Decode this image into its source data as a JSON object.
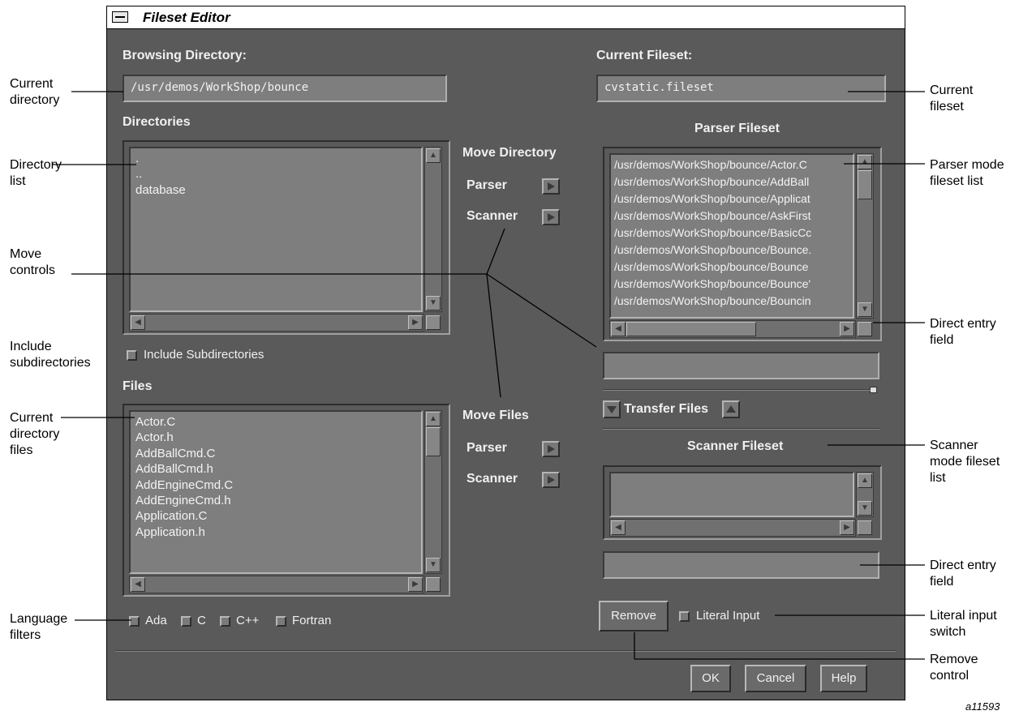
{
  "window": {
    "title": "Fileset Editor"
  },
  "left": {
    "browsing_label": "Browsing Directory:",
    "browsing_value": "/usr/demos/WorkShop/bounce",
    "directories_label": "Directories",
    "directories": [
      ".",
      "..",
      "database"
    ],
    "include_sub_label": "Include Subdirectories",
    "files_label": "Files",
    "files": [
      "Actor.C",
      "Actor.h",
      "AddBallCmd.C",
      "AddBallCmd.h",
      "AddEngineCmd.C",
      "AddEngineCmd.h",
      "Application.C",
      "Application.h"
    ],
    "filters": [
      "Ada",
      "C",
      "C++",
      "Fortran"
    ]
  },
  "middle": {
    "move_directory_label": "Move Directory",
    "move_files_label": "Move Files",
    "parser_label": "Parser",
    "scanner_label": "Scanner"
  },
  "right": {
    "current_fileset_label": "Current Fileset:",
    "current_fileset_value": "cvstatic.fileset",
    "parser_fileset_label": "Parser Fileset",
    "parser_files": [
      "/usr/demos/WorkShop/bounce/Actor.C",
      "/usr/demos/WorkShop/bounce/AddBall",
      "/usr/demos/WorkShop/bounce/Applicat",
      "/usr/demos/WorkShop/bounce/AskFirst",
      "/usr/demos/WorkShop/bounce/BasicCc",
      "/usr/demos/WorkShop/bounce/Bounce.",
      "/usr/demos/WorkShop/bounce/Bounce",
      "/usr/demos/WorkShop/bounce/Bounce'",
      "/usr/demos/WorkShop/bounce/Bouncin"
    ],
    "transfer_label": "Transfer Files",
    "scanner_fileset_label": "Scanner Fileset",
    "remove_label": "Remove",
    "literal_input_label": "Literal Input"
  },
  "footer": {
    "ok": "OK",
    "cancel": "Cancel",
    "help": "Help"
  },
  "callouts": {
    "current_directory": [
      "Current",
      "directory"
    ],
    "directory_list": [
      "Directory",
      "list"
    ],
    "move_controls": [
      "Move",
      "controls"
    ],
    "include_subdirectories": [
      "Include",
      "subdirectories"
    ],
    "current_directory_files": [
      "Current",
      "directory",
      "files"
    ],
    "language_filters": [
      "Language",
      "filters"
    ],
    "current_fileset": [
      "Current",
      "fileset"
    ],
    "parser_mode_fileset_list": [
      "Parser mode",
      "fileset list"
    ],
    "direct_entry_field_1": [
      "Direct entry",
      "field"
    ],
    "scanner_mode_fileset_list": [
      "Scanner",
      "mode fileset",
      "list"
    ],
    "direct_entry_field_2": [
      "Direct entry",
      "field"
    ],
    "literal_input_switch": [
      "Literal input",
      "switch"
    ],
    "remove_control": [
      "Remove",
      "control"
    ]
  },
  "figure_id": "a11593"
}
